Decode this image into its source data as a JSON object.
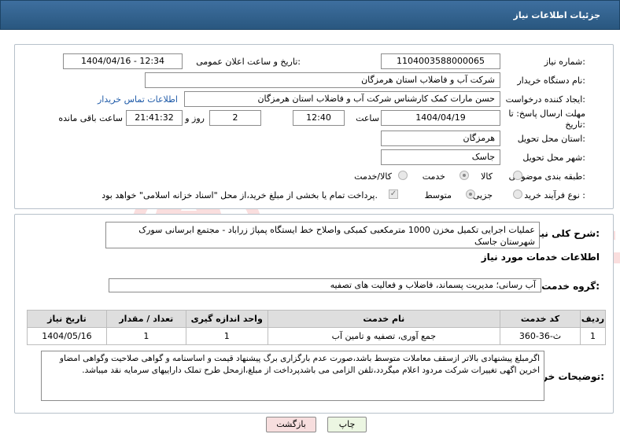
{
  "header": {
    "title": "جزئیات اطلاعات نیاز"
  },
  "form": {
    "need_number_label": "شماره نیاز:",
    "need_number": "1104003588000065",
    "announce_label": "تاریخ و ساعت اعلان عمومی:",
    "announce_value": "1404/04/16 - 12:34",
    "buyer_org_label": "نام دستگاه خریدار:",
    "buyer_org": "شرکت آب و فاضلاب استان هرمزگان",
    "creator_label": "ایجاد کننده درخواست:",
    "creator": "حسن مارات کمک کارشناس شرکت آب و فاضلاب استان هرمزگان",
    "contact_link": "اطلاعات تماس خریدار",
    "deadline_label_line1": "مهلت ارسال پاسخ: تا",
    "deadline_label_line2": "تاریخ:",
    "deadline_date": "1404/04/19",
    "time_label": "ساعت",
    "deadline_time": "12:40",
    "days_value": "2",
    "days_label": "روز و",
    "remaining_time": "21:41:32",
    "remaining_label": "ساعت باقی مانده",
    "province_label": "استان محل تحویل:",
    "province": "هرمزگان",
    "city_label": "شهر محل تحویل:",
    "city": "جاسک",
    "category_label": "طبقه بندی موضوعی:",
    "category_options": [
      "کالا",
      "خدمت",
      "کالا/خدمت"
    ],
    "process_label": "نوع فرآیند خرید :",
    "process_options": [
      "جزیی",
      "متوسط"
    ],
    "payment_note": "پرداخت تمام یا بخشی از مبلغ خرید،از محل \"اسناد خزانه اسلامی\" خواهد بود."
  },
  "summary": {
    "label": "شرح کلی نیاز:",
    "text": "عملیات اجرایی تکمیل مخزن 1000 مترمکعبی کمبکی واصلاح خط ایستگاه پمپاژ زراباد - مجتمع ابرسانی سورک شهرستان جاسک"
  },
  "services": {
    "section_title": "اطلاعات خدمات مورد نیاز",
    "group_label": "گروه خدمت:",
    "group_value": "آب رسانی؛ مدیریت پسماند، فاضلاب و فعالیت های تصفیه",
    "columns": [
      "ردیف",
      "کد خدمت",
      "نام خدمت",
      "واحد اندازه گیری",
      "تعداد / مقدار",
      "تاریخ نیاز"
    ],
    "rows": [
      [
        "1",
        "ث-36-360",
        "جمع آوری، تصفیه و تامین آب",
        "1",
        "1",
        "1404/05/16"
      ]
    ]
  },
  "notes": {
    "label": "توضیحات خریدار:",
    "text": "اگرمبلغ پیشنهادی بالاتر ازسقف معاملات متوسط باشد،صورت عدم بارگزاری برگ پیشنهاد قیمت و اساسنامه و گواهی صلاحیت وگواهی امضاو اخرین اگهی تغییرات شرکت مردود اعلام میگردد،تلفن الزامی می باشدپرداخت از مبلغ،ازمحل طرح تملک داراییهای سرمایه نقد میباشد."
  },
  "buttons": {
    "print": "چاپ",
    "back": "بازگشت"
  },
  "watermark": {
    "text": "AriaTender.neT"
  },
  "colors": {
    "header": "#2f5f8c",
    "back_button": "#f7dede",
    "print_button": "#ecf6e2",
    "watermark": "#e33a3a"
  }
}
